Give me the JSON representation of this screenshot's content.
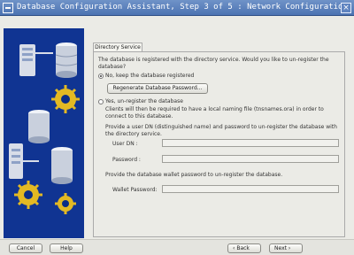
{
  "window": {
    "title": "Database Configuration Assistant, Step 3 of 5 : Network Configuration",
    "close_glyph": "×"
  },
  "tab": {
    "label": "Directory Service"
  },
  "content": {
    "question": "The database is registered with the directory service. Would you like to un-register the database?",
    "option_keep_label": "No, keep the database registered",
    "regenerate_button": "Regenerate Database Password...",
    "option_unregister_label": "Yes, un-register the database",
    "unregister_note": "Clients will then be required to have a local naming file (tnsnames.ora) in order to connect to this database.",
    "dn_prompt": "Provide a user DN (distinguished name) and password to un-register the database with the directory service.",
    "user_dn_label": "User DN :",
    "user_dn_value": "",
    "password_label": "Password :",
    "password_value": "",
    "wallet_prompt": "Provide the database wallet password to un-register the database.",
    "wallet_label": "Wallet Password:",
    "wallet_value": "",
    "selected_option": "keep"
  },
  "footer": {
    "cancel": "Cancel",
    "help": "Help",
    "back": "Back",
    "next": "Next"
  },
  "colors": {
    "accent": "#4c73b2",
    "titlebar": "#4c73b2"
  }
}
